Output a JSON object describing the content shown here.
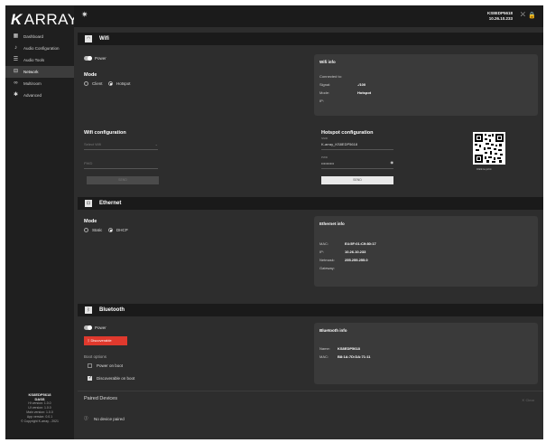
{
  "app": {
    "logo_k": "K",
    "logo_text": "ARRAY"
  },
  "sidebar": {
    "items": [
      {
        "label": "Dashboard",
        "icon": "dashboard-icon",
        "glyph": "▦"
      },
      {
        "label": "Audio Configuration",
        "icon": "music-note-icon",
        "glyph": "♪"
      },
      {
        "label": "Audio Tools",
        "icon": "sliders-icon",
        "glyph": "☰"
      },
      {
        "label": "Network",
        "icon": "network-icon",
        "glyph": "⊟"
      },
      {
        "label": "Multiroom",
        "icon": "link-icon",
        "glyph": "∞"
      },
      {
        "label": "Advanced",
        "icon": "gear-icon",
        "glyph": "✱"
      }
    ],
    "footer": {
      "device": "KS8EDP5618",
      "sub": "DASS",
      "line1": "Hi version: 1.0.0",
      "line2": "UI version: 1.0.0",
      "line3": "Main version: 1.0.0",
      "line4": "App version: 0.0.1",
      "copyright": "© Copyright K-array - 2021"
    }
  },
  "topbar": {
    "device_name": "KS8EDP5618",
    "ip": "10.26.10.233"
  },
  "wifi": {
    "title": "Wifi",
    "power_label": "Power",
    "mode_label": "Mode",
    "client_label": "Client",
    "hotspot_label": "Hotspot",
    "info": {
      "title": "Wifi info",
      "connected_to": "Connected to:",
      "signal_k": "Signal:",
      "signal_v": "-/100",
      "mode_k": "Mode:",
      "mode_v": "Hotspot",
      "ip_k": "IP:"
    },
    "config": {
      "title": "Wifi configuration",
      "select_placeholder": "Select Wifi",
      "pwd_placeholder": "PWD",
      "send_label": "SEND"
    },
    "hotspot": {
      "title": "Hotspot configuration",
      "ssid_label": "SSID",
      "ssid_value": "K-array_KS8EDP5618",
      "pwd_label": "PWD",
      "pwd_value": "••••••••••",
      "send_label": "SEND",
      "qr_caption": "Click to print"
    }
  },
  "ethernet": {
    "title": "Ethernet",
    "mode_label": "Mode",
    "static_label": "Static",
    "dhcp_label": "DHCP",
    "info": {
      "title": "Ethernet info",
      "mac_k": "MAC:",
      "mac_v": "E4:5F:01:C9:80:17",
      "ip_k": "IP:",
      "ip_v": "10.26.10.233",
      "netmask_k": "Netmask:",
      "netmask_v": "255.255.255.0",
      "gateway_k": "Gateway:"
    }
  },
  "bluetooth": {
    "title": "Bluetooth",
    "power_label": "Power",
    "discoverable_label": "Discoverable",
    "boot_label": "Boot options",
    "power_on_boot": "Power on boot",
    "discoverable_on_boot": "Discoverable on boot",
    "info": {
      "title": "Bluetooth info",
      "name_k": "Name:",
      "name_v": "KS8EDP5618",
      "mac_k": "MAC:",
      "mac_v": "B8:1A:7D:DA:71:11"
    }
  },
  "paired": {
    "title": "Paired Devices",
    "clear_label": "Clear",
    "empty_label": "No device paired"
  },
  "colors": {
    "accent_red": "#e0392d",
    "bg": "#2d2d2d",
    "sidebar": "#1f1f1f"
  }
}
